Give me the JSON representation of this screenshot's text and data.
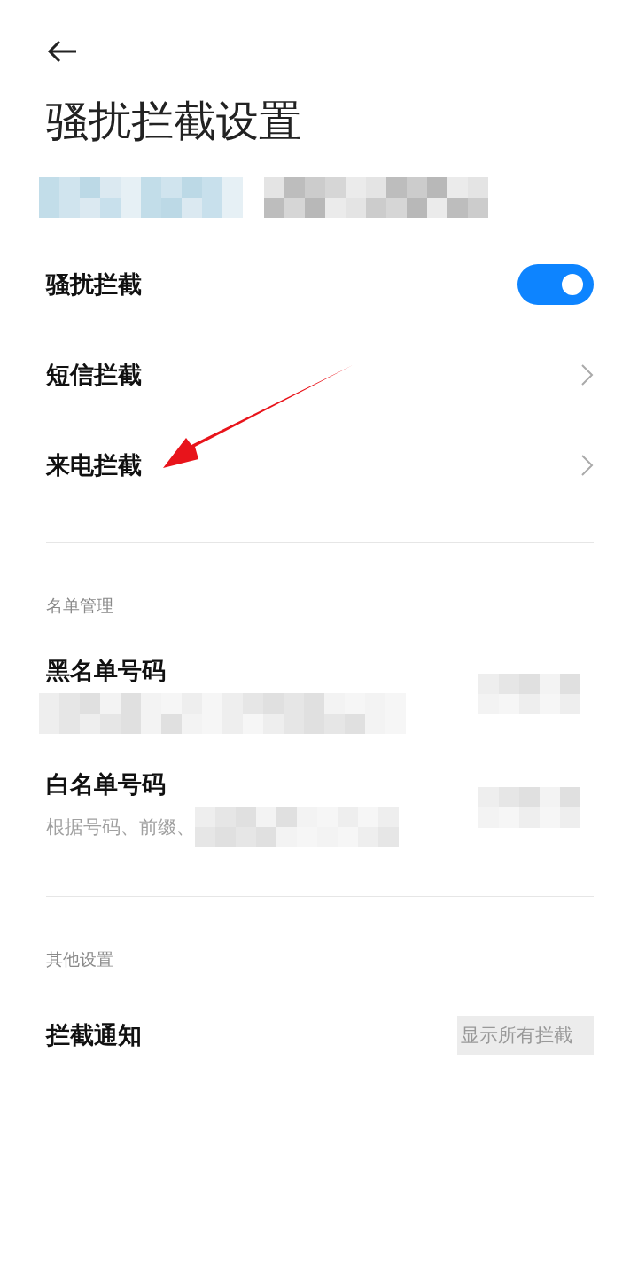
{
  "title": "骚扰拦截设置",
  "account_banner": {
    "redacted": true
  },
  "main_settings": [
    {
      "label": "骚扰拦截",
      "kind": "toggle",
      "on": true
    },
    {
      "label": "短信拦截",
      "kind": "link"
    },
    {
      "label": "来电拦截",
      "kind": "link"
    }
  ],
  "sections": [
    {
      "header": "名单管理",
      "items": [
        {
          "label": "黑名单号码",
          "subtitle_redacted": true,
          "value_redacted": true
        },
        {
          "label": "白名单号码",
          "subtitle": "根据号码、前缀、",
          "subtitle_redacted": true,
          "value_redacted": true
        }
      ]
    },
    {
      "header": "其他设置",
      "items": [
        {
          "label": "拦截通知",
          "value": "显示所有拦截",
          "value_redacted": true
        }
      ]
    }
  ],
  "annotations": [
    {
      "kind": "arrow"
    }
  ]
}
